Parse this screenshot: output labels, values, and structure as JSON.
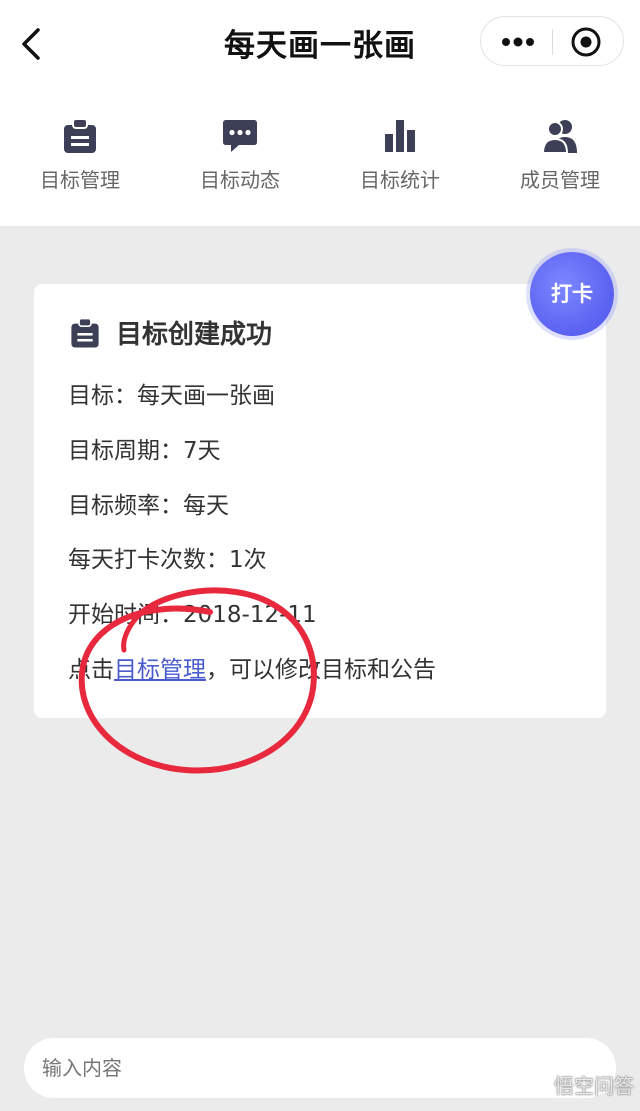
{
  "header": {
    "title": "每天画一张画"
  },
  "tabs": [
    {
      "label": "目标管理",
      "icon": "clipboard-icon"
    },
    {
      "label": "目标动态",
      "icon": "chat-bubble-icon"
    },
    {
      "label": "目标统计",
      "icon": "bar-chart-icon"
    },
    {
      "label": "成员管理",
      "icon": "members-icon"
    }
  ],
  "card": {
    "title": "目标创建成功",
    "goal": "目标：每天画一张画",
    "period": "目标周期：7天",
    "frequency": "目标频率：每天",
    "checkin_times": "每天打卡次数：1次",
    "start_time": "开始时间：2018-12-11",
    "hint_prefix": "点击",
    "hint_link": "目标管理",
    "hint_suffix": "，可以修改目标和公告"
  },
  "checkin_button": {
    "label": "打卡"
  },
  "input": {
    "placeholder": "输入内容"
  },
  "watermark": "悟空问答",
  "colors": {
    "accent": "#5b61f0",
    "link": "#4a5ccc",
    "annotation": "#e8283c",
    "icon": "#3c3f55"
  }
}
